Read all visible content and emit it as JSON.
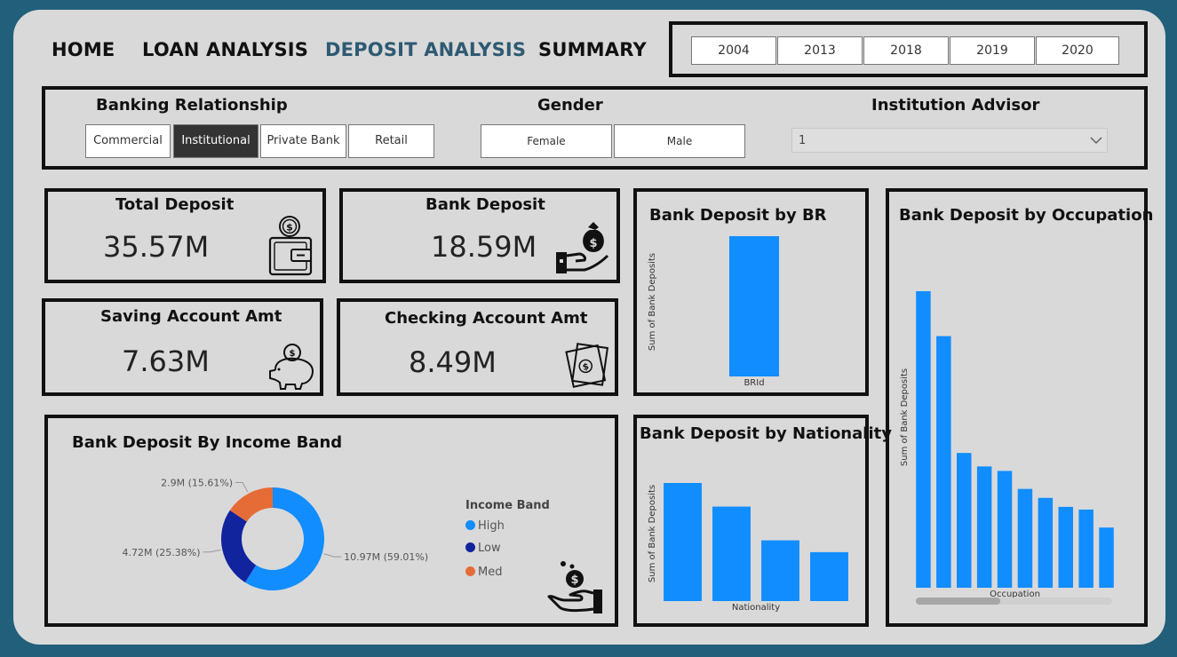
{
  "nav": {
    "home": "HOME",
    "loan": "LOAN ANALYSIS",
    "deposit": "DEPOSIT ANALYSIS",
    "summary": "SUMMARY"
  },
  "years": [
    "2004",
    "2013",
    "2018",
    "2019",
    "2020"
  ],
  "filters": {
    "banking_relationship": {
      "title": "Banking Relationship",
      "options": [
        "Commercial",
        "Institutional",
        "Private Bank",
        "Retail"
      ],
      "selected": "Institutional"
    },
    "gender": {
      "title": "Gender",
      "options": [
        "Female",
        "Male"
      ]
    },
    "advisor": {
      "title": "Institution Advisor",
      "value": "1"
    }
  },
  "kpis": {
    "total_deposit": {
      "title": "Total Deposit",
      "value": "35.57M"
    },
    "bank_deposit": {
      "title": "Bank Deposit",
      "value": "18.59M"
    },
    "saving": {
      "title": "Saving Account Amt",
      "value": "7.63M"
    },
    "checking": {
      "title": "Checking Account Amt",
      "value": "8.49M"
    }
  },
  "colors": {
    "bar": "#118dff",
    "high": "#118dff",
    "low": "#12239e",
    "med": "#e66c37"
  },
  "charts": {
    "income_band": {
      "title": "Bank Deposit By Income Band",
      "legend_title": "Income Band"
    },
    "br": {
      "title": "Bank Deposit by BR"
    },
    "nationality": {
      "title": "Bank Deposit by Nationality"
    },
    "occupation": {
      "title": "Bank Deposit by Occupation"
    }
  },
  "chart_data": [
    {
      "type": "pie",
      "title": "Bank Deposit By Income Band",
      "slices": [
        {
          "name": "High",
          "value": 10.97,
          "label": "10.97M (59.01%)"
        },
        {
          "name": "Low",
          "value": 4.72,
          "label": "4.72M (25.38%)"
        },
        {
          "name": "Med",
          "value": 2.9,
          "label": "2.9M (15.61%)"
        }
      ]
    },
    {
      "type": "bar",
      "title": "Bank Deposit by BR",
      "xlabel": "BRId",
      "ylabel": "Sum of Bank Deposits",
      "values": [
        18.59
      ]
    },
    {
      "type": "bar",
      "title": "Bank Deposit by Nationality",
      "xlabel": "Nationality",
      "ylabel": "Sum of Bank Deposits",
      "values": [
        7.0,
        5.6,
        3.6,
        2.9
      ]
    },
    {
      "type": "bar",
      "title": "Bank Deposit by Occupation",
      "xlabel": "Occupation",
      "ylabel": "Sum of Bank Deposits",
      "values": [
        3.3,
        2.8,
        1.5,
        1.35,
        1.3,
        1.1,
        1.0,
        0.9,
        0.87,
        0.67
      ]
    }
  ]
}
